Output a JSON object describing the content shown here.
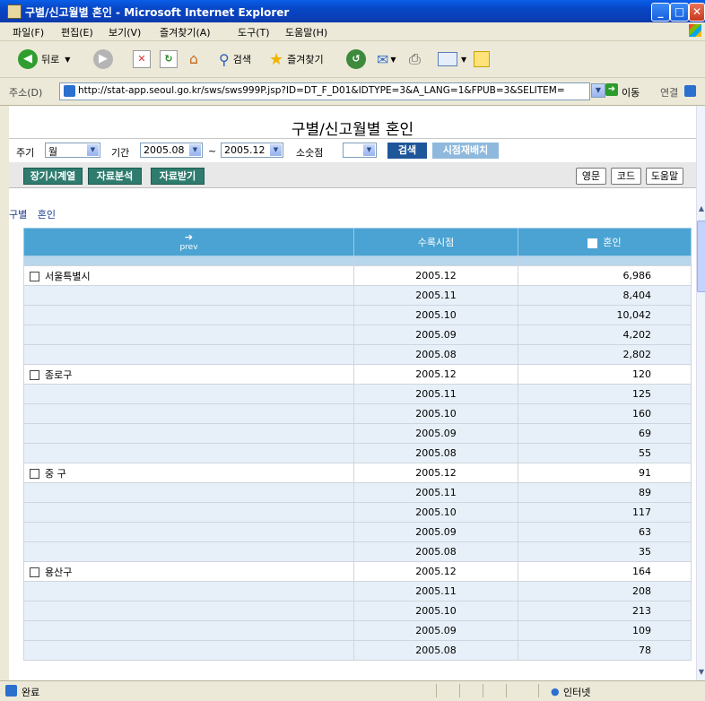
{
  "window": {
    "title": "구별/신고월별 혼인 - Microsoft Internet Explorer"
  },
  "menu": [
    "파일(F)",
    "편집(E)",
    "보기(V)",
    "즐겨찾기(A)",
    "도구(T)",
    "도움말(H)"
  ],
  "toolbar": {
    "back": "뒤로",
    "search": "검색",
    "favorites": "즐겨찾기"
  },
  "address": {
    "label": "주소(D)",
    "url": "http://stat-app.seoul.go.kr/sws/sws999P.jsp?ID=DT_F_D01&IDTYPE=3&A_LANG=1&FPUB=3&SELITEM=",
    "go": "이동",
    "links": "연결"
  },
  "page": {
    "title": "구별/신고월별 혼인",
    "filters": {
      "period_label": "주기",
      "period_value": "월",
      "range_label": "기간",
      "from": "2005.08",
      "tilde": "~",
      "to": "2005.12",
      "decimal_label": "소숫점",
      "decimal_value": "",
      "search": "검색",
      "rearrange": "시점재배치"
    },
    "actions": {
      "timeseries": "장기시계열",
      "analysis": "자료분석",
      "download": "자료받기",
      "english": "영문",
      "code": "코드",
      "help": "도움말"
    },
    "breadcrumb": [
      "구별",
      "혼인"
    ]
  },
  "table": {
    "prev": "prev",
    "col_time": "수록시점",
    "col_value": "혼인",
    "rows": [
      {
        "district": "서울특별시",
        "time": "2005.12",
        "value": "6,986"
      },
      {
        "district": "",
        "time": "2005.11",
        "value": "8,404"
      },
      {
        "district": "",
        "time": "2005.10",
        "value": "10,042"
      },
      {
        "district": "",
        "time": "2005.09",
        "value": "4,202"
      },
      {
        "district": "",
        "time": "2005.08",
        "value": "2,802"
      },
      {
        "district": "종로구",
        "time": "2005.12",
        "value": "120"
      },
      {
        "district": "",
        "time": "2005.11",
        "value": "125"
      },
      {
        "district": "",
        "time": "2005.10",
        "value": "160"
      },
      {
        "district": "",
        "time": "2005.09",
        "value": "69"
      },
      {
        "district": "",
        "time": "2005.08",
        "value": "55"
      },
      {
        "district": "중 구",
        "time": "2005.12",
        "value": "91"
      },
      {
        "district": "",
        "time": "2005.11",
        "value": "89"
      },
      {
        "district": "",
        "time": "2005.10",
        "value": "117"
      },
      {
        "district": "",
        "time": "2005.09",
        "value": "63"
      },
      {
        "district": "",
        "time": "2005.08",
        "value": "35"
      },
      {
        "district": "용산구",
        "time": "2005.12",
        "value": "164"
      },
      {
        "district": "",
        "time": "2005.11",
        "value": "208"
      },
      {
        "district": "",
        "time": "2005.10",
        "value": "213"
      },
      {
        "district": "",
        "time": "2005.09",
        "value": "109"
      },
      {
        "district": "",
        "time": "2005.08",
        "value": "78"
      }
    ]
  },
  "status": {
    "left": "완료",
    "zone": "인터넷"
  },
  "colors": {
    "header": "#4aa3d2",
    "alt_row": "#e7f0f8",
    "dark_button": "#1e5799",
    "green_button": "#2f7c6e"
  }
}
